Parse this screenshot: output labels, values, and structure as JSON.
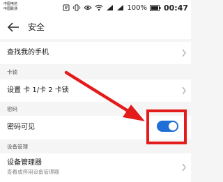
{
  "status_bar": {
    "carrier_1": "中国电信",
    "carrier_2": "中国联通",
    "battery": "100%",
    "time": "00:47"
  },
  "header": {
    "title": "安全"
  },
  "rows": {
    "find_phone": "查找我的手机",
    "sim_lock_section": "卡锁",
    "sim_lock_setting": "设置 卡 1/卡 2 卡锁",
    "password_section": "密码",
    "password_visible": "密码可见",
    "device_admin_section": "设备管理",
    "device_admin": "设备管理器",
    "device_admin_sub": "查看或停用设备管理器"
  },
  "toggle": {
    "password_visible_on": true
  },
  "colors": {
    "accent": "#1f6fd6",
    "annotation": "#e31b1b",
    "background": "#f5f5f5"
  }
}
